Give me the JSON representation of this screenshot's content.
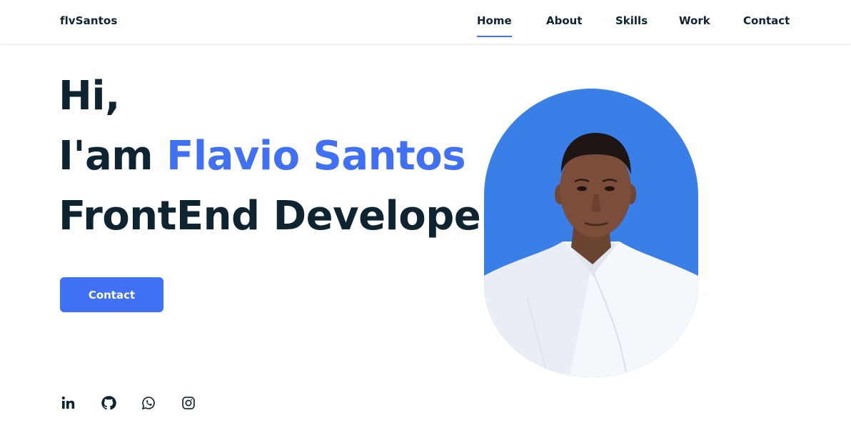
{
  "header": {
    "logo": "flvSantos",
    "nav": [
      {
        "label": "Home",
        "active": true
      },
      {
        "label": "About",
        "active": false
      },
      {
        "label": "Skills",
        "active": false
      },
      {
        "label": "Work",
        "active": false
      },
      {
        "label": "Contact",
        "active": false
      }
    ]
  },
  "hero": {
    "greeting": "Hi,",
    "intro_prefix": "I'am ",
    "name": "Flavio Santos",
    "role": "FrontEnd Developer",
    "cta_label": "Contact"
  },
  "social": [
    {
      "icon": "linkedin-icon"
    },
    {
      "icon": "github-icon"
    },
    {
      "icon": "whatsapp-icon"
    },
    {
      "icon": "instagram-icon"
    }
  ],
  "colors": {
    "accent": "#4070f4",
    "text": "#0e2431",
    "portrait_bg": "#3a7fe8"
  }
}
